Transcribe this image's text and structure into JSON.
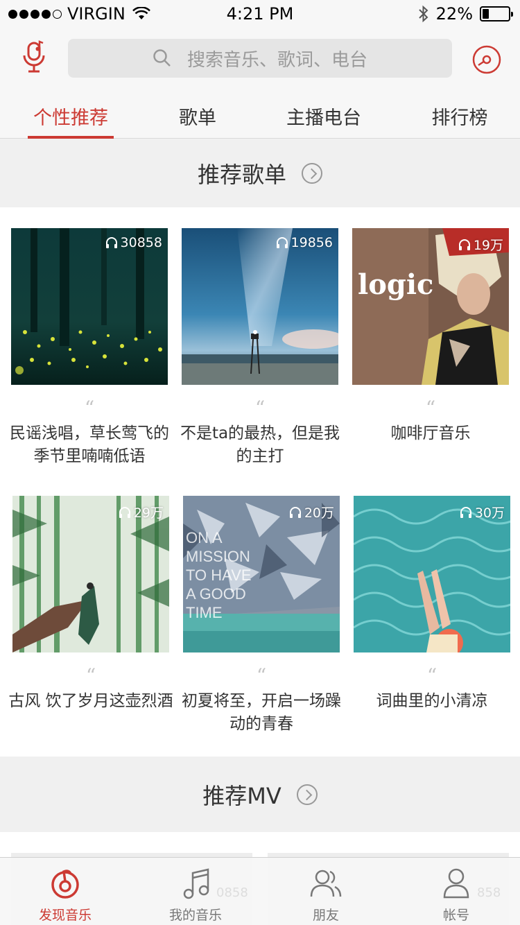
{
  "status": {
    "carrier": "VIRGIN",
    "time": "4:21 PM",
    "battery": "22%",
    "battery_level": 0.22,
    "signal_bars_filled": 4,
    "signal_bars_total": 5
  },
  "search": {
    "placeholder": "搜索音乐、歌词、电台"
  },
  "tabs": [
    {
      "label": "个性推荐",
      "active": true
    },
    {
      "label": "歌单",
      "active": false
    },
    {
      "label": "主播电台",
      "active": false
    },
    {
      "label": "排行榜",
      "active": false
    }
  ],
  "sections": {
    "playlists": "推荐歌单",
    "mv": "推荐MV"
  },
  "playlists": [
    {
      "count": "30858",
      "quote": "“",
      "title": "民谣浅唱，草长莺飞的季节里喃喃低语"
    },
    {
      "count": "19856",
      "quote": "“",
      "title": "不是ta的最热，但是我的主打"
    },
    {
      "count": "19万",
      "quote": "“",
      "title": "咖啡厅音乐",
      "cover_text": "logic"
    },
    {
      "count": "29万",
      "quote": "“",
      "title": "古风 饮了岁月这壶烈酒"
    },
    {
      "count": "20万",
      "quote": "“",
      "title": "初夏将至，开启一场躁动的青春",
      "cover_text": "ON A MISSION TO HAVE A GOOD TIME"
    },
    {
      "count": "30万",
      "quote": "“",
      "title": "词曲里的小清凉"
    }
  ],
  "mv_counts": [
    "0858",
    "858"
  ],
  "tabbar": [
    {
      "label": "发现音乐",
      "icon": "netease-logo-icon",
      "active": true
    },
    {
      "label": "我的音乐",
      "icon": "music-note-icon",
      "active": false
    },
    {
      "label": "朋友",
      "icon": "friends-icon",
      "active": false
    },
    {
      "label": "帐号",
      "icon": "account-icon",
      "active": false
    }
  ],
  "colors": {
    "accent": "#cc3a33"
  }
}
